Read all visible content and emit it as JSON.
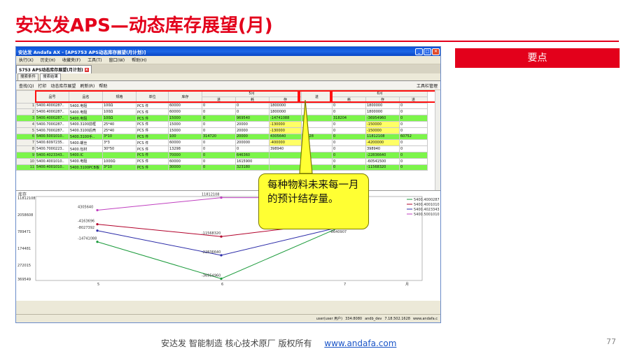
{
  "slide": {
    "title": "安达发APS—动态库存展望(月)",
    "keypoint_label": "要点",
    "callout_text": "每种物料未来每一月的预计结存量。",
    "footer_text": "安达发  智能制造 核心技术原厂   版权所有",
    "footer_link": "www.andafa.com",
    "page_number": "77"
  },
  "app": {
    "window_title": "安达发 Andafa AX - [APS753 APS动态库存展望(月计划)]",
    "menu": [
      "执行(X)",
      "历史(H)",
      "收藏夹(F)",
      "工具(T)",
      "窗口(W)",
      "帮助(H)"
    ],
    "doc_tab": "S753 APS动态库存展望(月计划)",
    "subtabs": [
      "搜索条件",
      "搜索结果"
    ],
    "toolbar": [
      "查找(Q)",
      "打印",
      "动态库存展望",
      "刷新(R)",
      "帮助"
    ],
    "toolbar_right": "工具栏管理",
    "status": [
      "user(user 用户)",
      "334:8080",
      "andb_dev",
      "7.18.502.1628",
      "www.andafa.c"
    ]
  },
  "table": {
    "headers": [
      "品号",
      "品名",
      "规格",
      "单位",
      "库存"
    ],
    "month1": "5月",
    "month2": "6月",
    "sub_headers": [
      "进",
      "耗",
      "存",
      "进",
      "耗",
      "存",
      "进"
    ],
    "rows": [
      {
        "n": "1",
        "cells": [
          "5400.4000287..",
          "5400.电阻",
          "100Ω",
          "PCS 件",
          "60000",
          "0",
          "0",
          "1800000",
          "",
          "0",
          "1800000",
          "0"
        ],
        "style": ""
      },
      {
        "n": "2",
        "cells": [
          "5400.4000287..",
          "5400.电阻",
          "100Ω",
          "PCS 件",
          "60000",
          "0",
          "0",
          "1800000",
          "",
          "0",
          "1800000",
          "0"
        ],
        "style": ""
      },
      {
        "n": "3",
        "cells": [
          "5400.4000287..",
          "5400.电阻",
          "100Ω",
          "PCS 件",
          "15000",
          "0",
          "969540",
          "-14741088",
          "",
          "318204",
          "-36954960",
          "0"
        ],
        "style": "green"
      },
      {
        "n": "4",
        "cells": [
          "5400.7000287..",
          "5400.3100前框",
          "25*40",
          "PCS 件",
          "15000",
          "0",
          "20000",
          "-130000",
          "",
          "0",
          "-150000",
          "0"
        ],
        "style": "",
        "yellow": [
          7,
          10
        ]
      },
      {
        "n": "5",
        "cells": [
          "5400.7000287..",
          "5400.3100后壳",
          "25*40",
          "PCS 件",
          "15000",
          "0",
          "20000",
          "-130000",
          "",
          "0",
          "-150000",
          "0"
        ],
        "style": "",
        "yellow": [
          7,
          10
        ]
      },
      {
        "n": "6",
        "cells": [
          "5400.5001010..",
          "5400.3100手..",
          "3*10",
          "PCS 件",
          "100",
          "314720",
          "20000",
          "4305640",
          "34528",
          "0",
          "11812108",
          "60752"
        ],
        "style": "sel"
      },
      {
        "n": "7",
        "cells": [
          "5400.6097235..",
          "5400.螺丝",
          "3*3",
          "PCS 件",
          "60000",
          "0",
          "200000",
          "-400000",
          "",
          "0",
          "-4200000",
          "0"
        ],
        "style": "",
        "yellow": [
          7,
          10
        ]
      },
      {
        "n": "8",
        "cells": [
          "5400.7000223..",
          "5400.包材",
          "30*50",
          "PCS 件",
          "13298",
          "0",
          "0",
          "398940",
          "",
          "0",
          "398940",
          "0"
        ],
        "style": ""
      },
      {
        "n": "9",
        "cells": [
          "5400.4023343..",
          "5400.IC",
          "",
          "PCS 件",
          "70000",
          "0",
          "646360",
          "",
          "",
          "0",
          "-22836640",
          "0"
        ],
        "style": "green"
      },
      {
        "n": "10",
        "cells": [
          "5400.4001010..",
          "5400.电阻",
          "1000Ω",
          "PCS 件",
          "60000",
          "0",
          "1615900",
          "",
          "",
          "0",
          "-60541500",
          "0"
        ],
        "style": ""
      },
      {
        "n": "11",
        "cells": [
          "5400.4001010..",
          "5400.3100PCB板",
          "3*10",
          "PCS 件",
          "30000",
          "0",
          "323180",
          "",
          "",
          "0",
          "-11568320",
          "0"
        ],
        "style": "green"
      }
    ]
  },
  "chart_data": {
    "type": "line",
    "ylabel": "库存",
    "xlabel": "月",
    "x": [
      "5",
      "6",
      "7"
    ],
    "y_ticks": [
      "11812108",
      "2058608",
      "789471",
      "174481",
      "272015",
      "369549"
    ],
    "series": [
      {
        "name": "5400.4000287",
        "color": "#1a9a3a",
        "values": [
          -14741088,
          -36954960,
          -5000000
        ],
        "labels": [
          "-14741088",
          "-36954960",
          ""
        ]
      },
      {
        "name": "5400.4001010",
        "color": "#b2002a",
        "values": [
          -4163696,
          -11568320,
          -2703536
        ],
        "labels": [
          "-4163696",
          "-11568320",
          "-2703536"
        ]
      },
      {
        "name": "5400.4023343",
        "color": "#2b2ba8",
        "values": [
          -8027392,
          -22836640,
          -5347000
        ],
        "labels": [
          "-8027392",
          "-22836640",
          "-5347073"
        ]
      },
      {
        "name": "5400.5001010",
        "color": "#c040c0",
        "values": [
          4305640,
          11812108,
          11812108
        ],
        "labels": [
          "4305640",
          "11812108",
          ""
        ]
      }
    ],
    "extra_labels": [
      "-8640907"
    ]
  }
}
